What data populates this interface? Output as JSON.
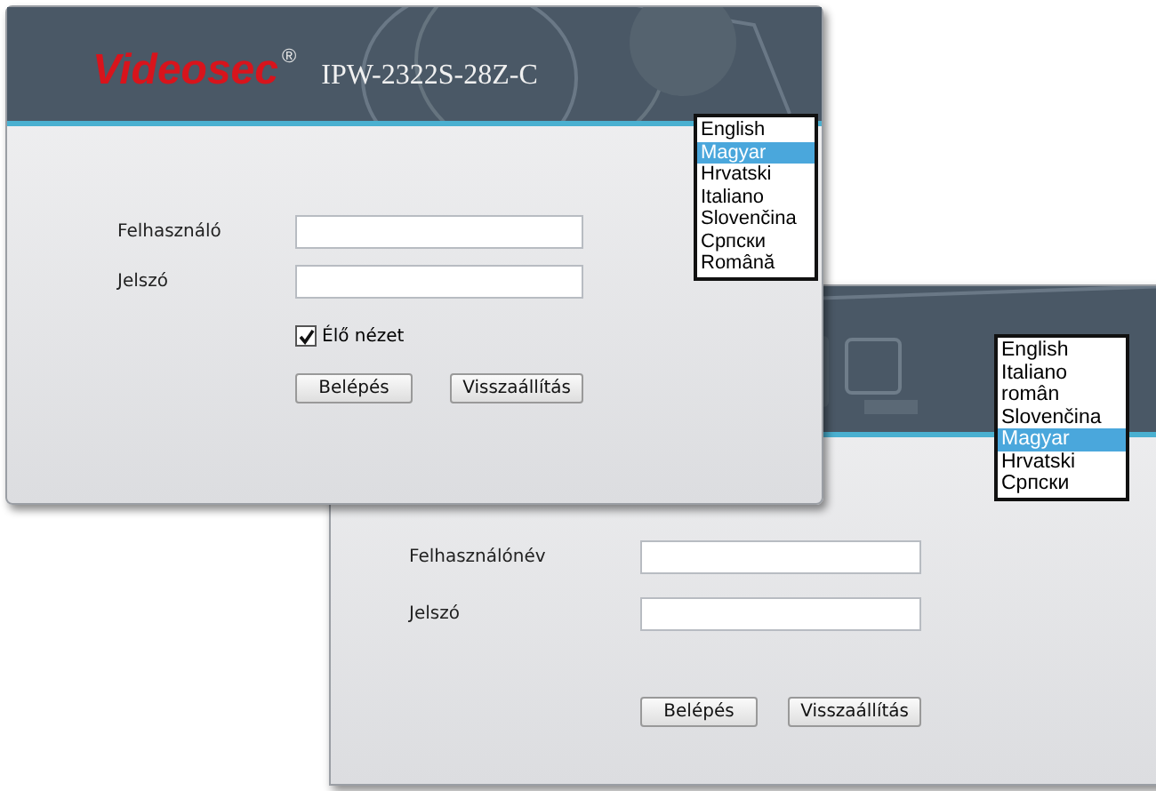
{
  "windows": [
    {
      "header": {
        "kind": "panel"
      },
      "languages": [
        {
          "label": "English",
          "selected": false
        },
        {
          "label": "Italiano",
          "selected": false
        },
        {
          "label": "român",
          "selected": false
        },
        {
          "label": "Slovenčina",
          "selected": false
        },
        {
          "label": "Magyar",
          "selected": true
        },
        {
          "label": "Hrvatski",
          "selected": false
        },
        {
          "label": "Српски",
          "selected": false
        }
      ],
      "fields": [
        {
          "label": "Felhasználónév"
        },
        {
          "label": "Jelszó"
        }
      ],
      "buttons": [
        "Belépés",
        "Visszaállítás"
      ]
    },
    {
      "header": {
        "kind": "camera",
        "brand": "Videosec",
        "mark": "®",
        "model": "IPW-2322S-28Z-C"
      },
      "languages": [
        {
          "label": "English",
          "selected": false
        },
        {
          "label": "Magyar",
          "selected": true
        },
        {
          "label": "Hrvatski",
          "selected": false
        },
        {
          "label": "Italiano",
          "selected": false
        },
        {
          "label": "Slovenčina",
          "selected": false
        },
        {
          "label": "Српски",
          "selected": false
        },
        {
          "label": "Română",
          "selected": false
        }
      ],
      "fields": [
        {
          "label": "Felhasználó"
        },
        {
          "label": "Jelszó"
        }
      ],
      "live_view": {
        "label": "Élő nézet",
        "checked": true
      },
      "buttons": [
        "Belépés",
        "Visszaállítás"
      ]
    }
  ]
}
